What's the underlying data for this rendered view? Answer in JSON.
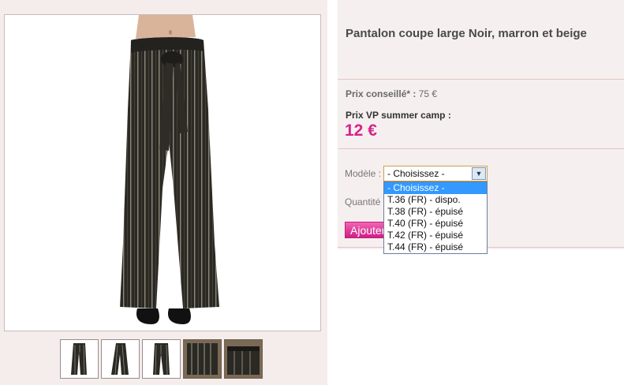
{
  "product": {
    "title": "Pantalon coupe large Noir, marron et beige",
    "msrp_label": "Prix conseillé* :",
    "msrp_value": "75 €",
    "vp_price_label": "Prix VP summer camp :",
    "vp_price": "12 €"
  },
  "form": {
    "modele_label": "Modèle :",
    "select_value": "- Choisissez -",
    "quantity_label": "Quantité",
    "add_button_label": "Ajouter au panier",
    "options": [
      "- Choisissez -",
      "T.36 (FR) - dispo.",
      "T.38 (FR) - épuisé",
      "T.40 (FR) - épuisé",
      "T.42 (FR) - épuisé",
      "T.44 (FR) - épuisé"
    ],
    "selected_option_index": 0
  },
  "thumbnails": [
    {
      "icon": "trousers-front-thumbnail",
      "dark": false
    },
    {
      "icon": "trousers-side-thumbnail",
      "dark": false
    },
    {
      "icon": "trousers-back-thumbnail",
      "dark": false
    },
    {
      "icon": "fabric-detail-thumbnail",
      "dark": true
    },
    {
      "icon": "waist-detail-thumbnail",
      "dark": true
    }
  ],
  "colors": {
    "accent_pink": "#d6238b",
    "panel_bg": "#f6efef",
    "divider": "#e6c4c4",
    "option_highlight": "#3399ff"
  }
}
